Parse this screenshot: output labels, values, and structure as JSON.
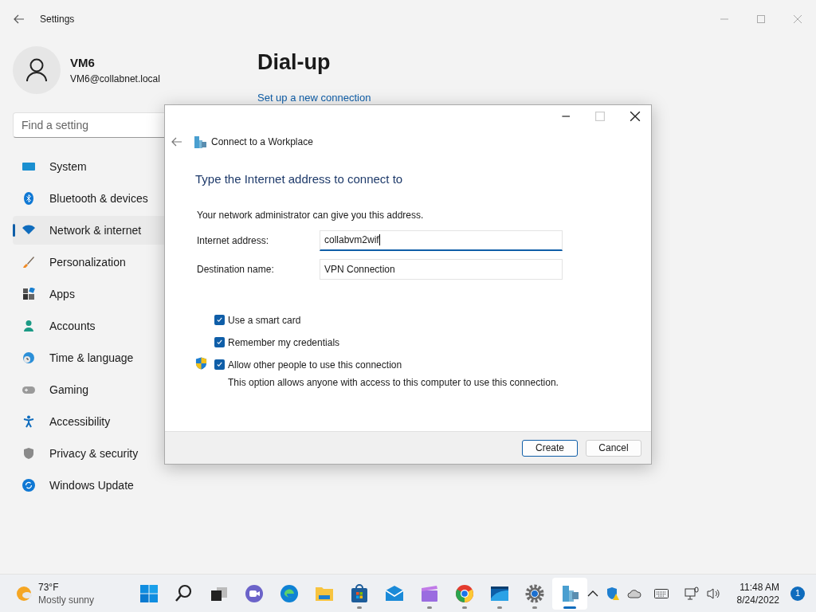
{
  "settings": {
    "title": "Settings",
    "user": {
      "name": "VM6",
      "email": "VM6@collabnet.local"
    },
    "search": {
      "placeholder": "Find a setting"
    },
    "sidebar": {
      "items": [
        {
          "label": "System",
          "selected": false
        },
        {
          "label": "Bluetooth & devices",
          "selected": false
        },
        {
          "label": "Network & internet",
          "selected": true
        },
        {
          "label": "Personalization",
          "selected": false
        },
        {
          "label": "Apps",
          "selected": false
        },
        {
          "label": "Accounts",
          "selected": false
        },
        {
          "label": "Time & language",
          "selected": false
        },
        {
          "label": "Gaming",
          "selected": false
        },
        {
          "label": "Accessibility",
          "selected": false
        },
        {
          "label": "Privacy & security",
          "selected": false
        },
        {
          "label": "Windows Update",
          "selected": false
        }
      ]
    },
    "page": {
      "title": "Dial-up",
      "link": "Set up a new connection"
    }
  },
  "dialog": {
    "title": "Connect to a Workplace",
    "heading": "Type the Internet address to connect to",
    "intro": "Your network administrator can give you this address.",
    "fields": [
      {
        "label": "Internet address:",
        "value": "collabvm2wif",
        "focused": true
      },
      {
        "label": "Destination name:",
        "value": "VPN Connection",
        "focused": false
      }
    ],
    "options": [
      {
        "label": "Use a smart card",
        "checked": true,
        "shield": false
      },
      {
        "label": "Remember my credentials",
        "checked": true,
        "shield": false
      },
      {
        "label": "Allow other people to use this connection",
        "checked": true,
        "shield": true,
        "note": "This option allows anyone with access to this computer to use this connection."
      }
    ],
    "buttons": [
      {
        "label": "Create",
        "default": true
      },
      {
        "label": "Cancel",
        "default": false
      }
    ]
  },
  "taskbar": {
    "weather": {
      "temperature": "73°F",
      "condition": "Mostly sunny"
    },
    "apps": [
      {
        "running": false,
        "active": false
      },
      {
        "running": false,
        "active": false
      },
      {
        "running": false,
        "active": false
      },
      {
        "running": false,
        "active": false
      },
      {
        "running": false,
        "active": false
      },
      {
        "running": false,
        "active": false
      },
      {
        "running": true,
        "active": false
      },
      {
        "running": false,
        "active": false
      },
      {
        "running": true,
        "active": false
      },
      {
        "running": true,
        "active": false
      },
      {
        "running": true,
        "active": false
      },
      {
        "running": true,
        "active": false
      },
      {
        "running": true,
        "active": true
      }
    ],
    "time": "11:48 AM",
    "date": "8/24/2022",
    "notifications": "1"
  }
}
